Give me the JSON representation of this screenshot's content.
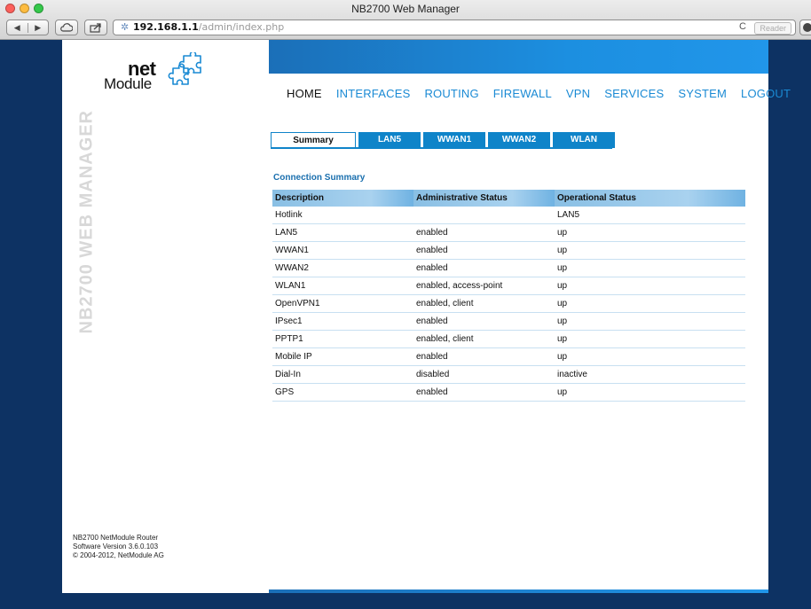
{
  "browser": {
    "window_title": "NB2700 Web Manager",
    "url_host": "192.168.1.1",
    "url_path": "/admin/index.php",
    "reader_label": "Reader",
    "reload_glyph": "C"
  },
  "logo": {
    "net": "net",
    "module": "Module"
  },
  "sidebar": {
    "vertical_title": "NB2700 WEB MANAGER",
    "footer": [
      "NB2700 NetModule Router",
      "Software Version 3.6.0.103",
      "© 2004-2012, NetModule AG"
    ]
  },
  "nav": {
    "items": [
      "HOME",
      "INTERFACES",
      "ROUTING",
      "FIREWALL",
      "VPN",
      "SERVICES",
      "SYSTEM",
      "LOGOUT"
    ],
    "active": "HOME"
  },
  "tabs": {
    "items": [
      "Summary",
      "LAN5",
      "WWAN1",
      "WWAN2",
      "WLAN"
    ],
    "active": "Summary"
  },
  "summary": {
    "title": "Connection Summary",
    "headers": [
      "Description",
      "Administrative Status",
      "Operational Status"
    ],
    "rows": [
      {
        "description": "Hotlink",
        "admin": "",
        "oper": "LAN5",
        "oper_type": "link"
      },
      {
        "description": "LAN5",
        "admin": "enabled",
        "oper": "up",
        "oper_type": "up"
      },
      {
        "description": "WWAN1",
        "admin": "enabled",
        "oper": "up",
        "oper_type": "up"
      },
      {
        "description": "WWAN2",
        "admin": "enabled",
        "oper": "up",
        "oper_type": "up"
      },
      {
        "description": "WLAN1",
        "admin": "enabled, access-point",
        "oper": "up",
        "oper_type": "up"
      },
      {
        "description": "OpenVPN1",
        "admin": "enabled, client",
        "oper": "up",
        "oper_type": "up"
      },
      {
        "description": "IPsec1",
        "admin": "enabled",
        "oper": "up",
        "oper_type": "up"
      },
      {
        "description": "PPTP1",
        "admin": "enabled, client",
        "oper": "up",
        "oper_type": "up"
      },
      {
        "description": "Mobile IP",
        "admin": "enabled",
        "oper": "up",
        "oper_type": "up"
      },
      {
        "description": "Dial-In",
        "admin": "disabled",
        "oper": "inactive",
        "oper_type": "inactive"
      },
      {
        "description": "GPS",
        "admin": "enabled",
        "oper": "up",
        "oper_type": "up"
      }
    ]
  },
  "colors": {
    "page_bg": "#0d3263",
    "accent_blue": "#1a8ad4",
    "tab_blue": "#0f84c9",
    "status_up": "#4aa53b",
    "status_link": "#1f2fd0"
  }
}
